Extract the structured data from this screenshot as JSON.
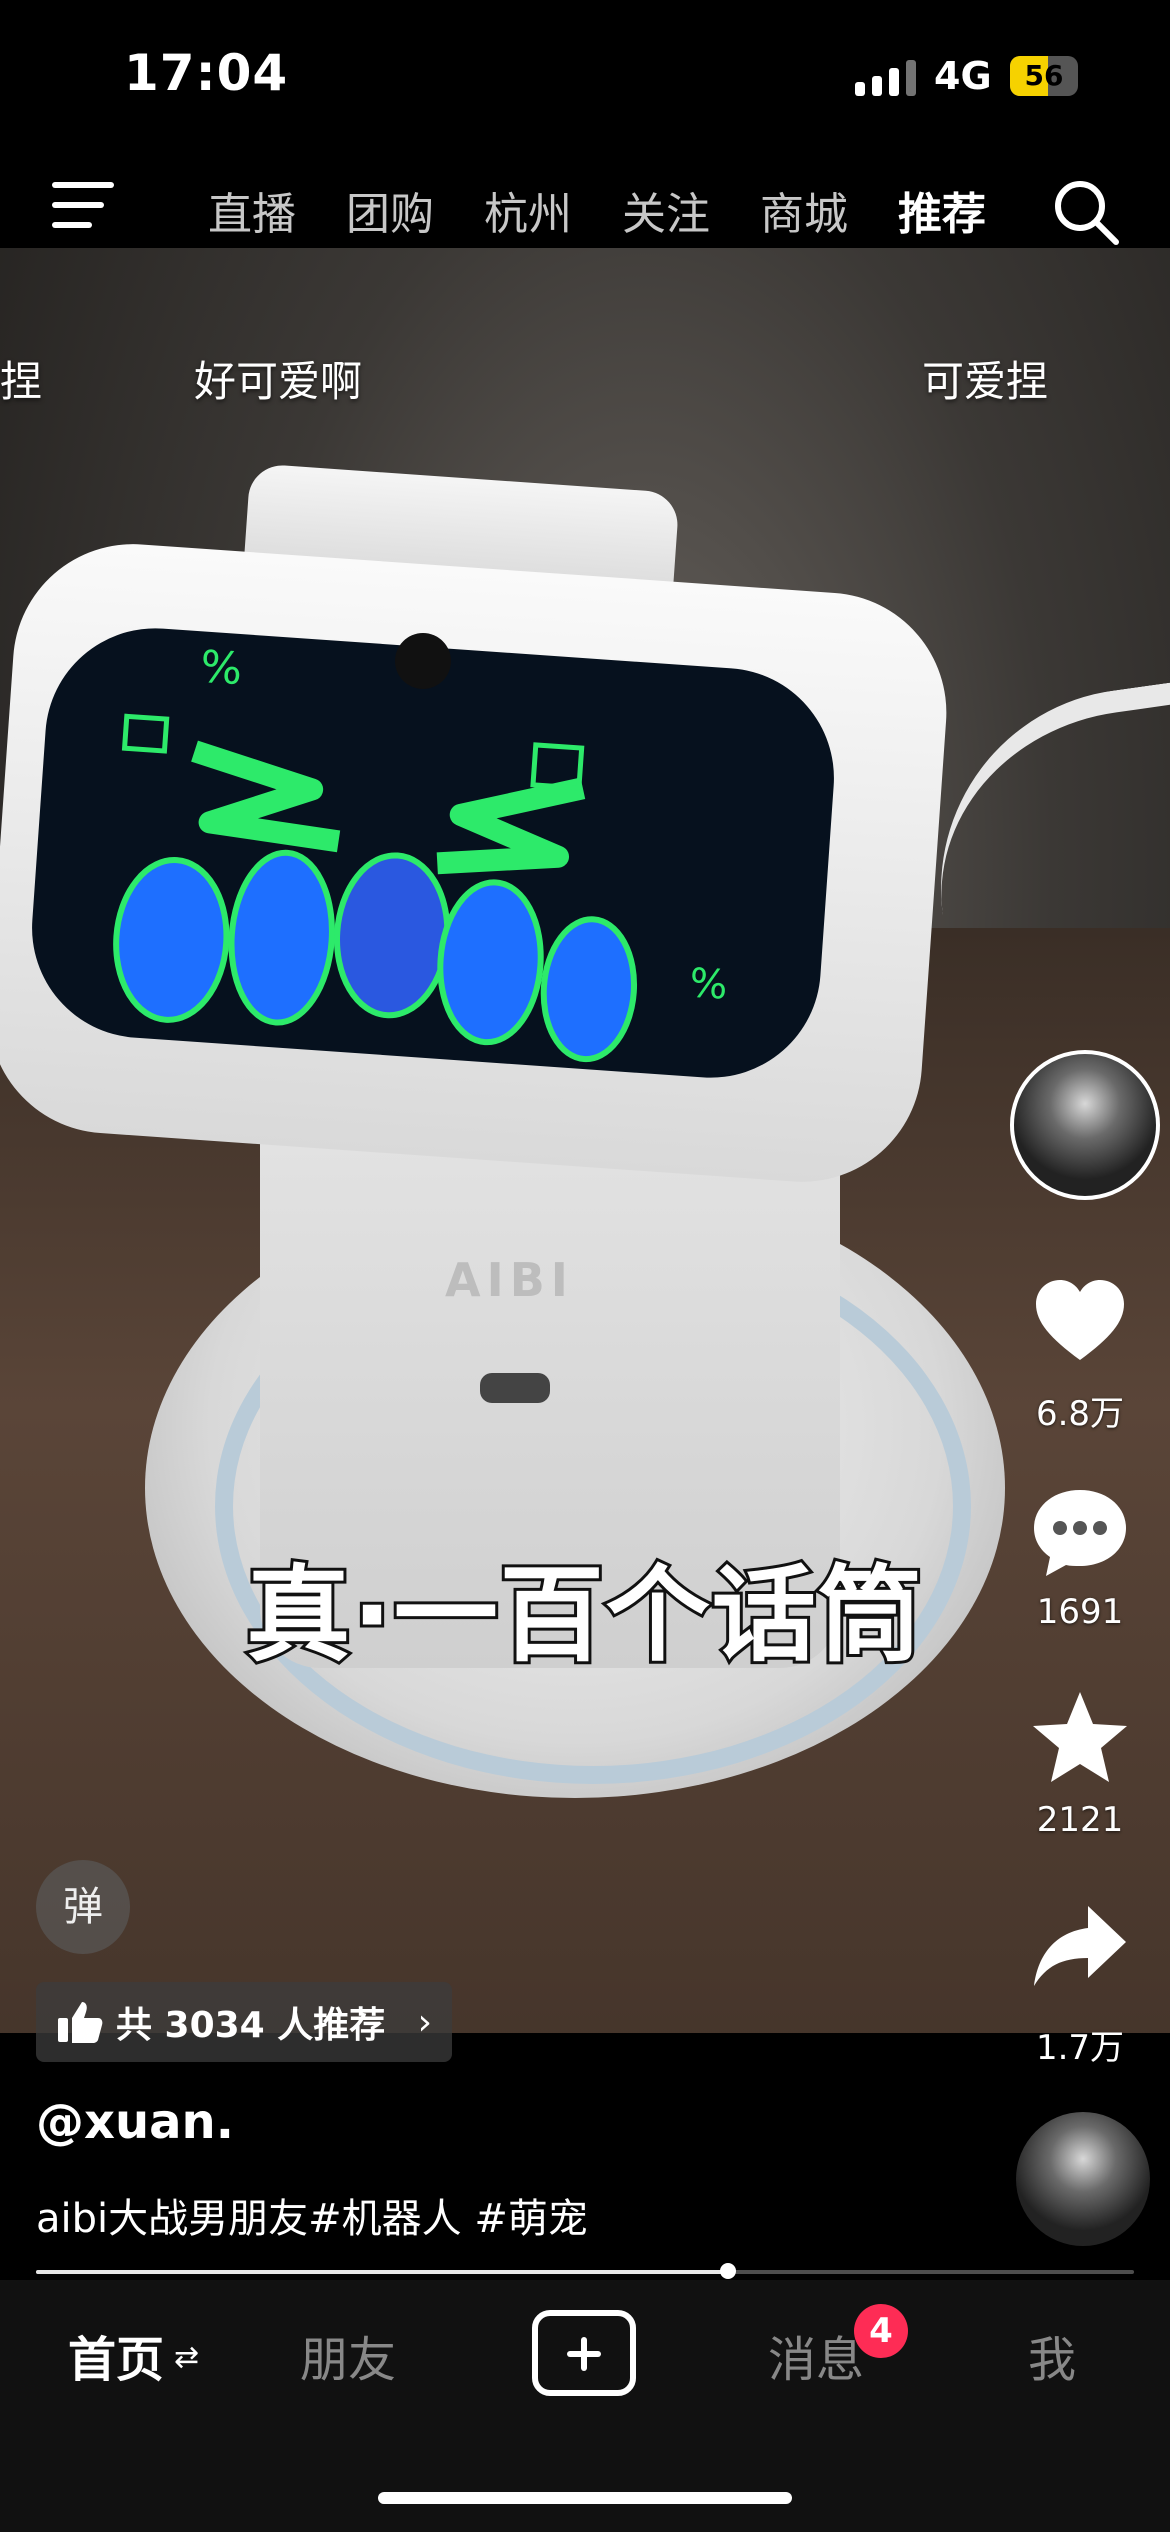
{
  "status_bar": {
    "time": "17:04",
    "network": "4G",
    "battery": "56",
    "battery_level": 0.56
  },
  "top_nav": {
    "tabs": [
      "直播",
      "团购",
      "杭州",
      "关注",
      "商城",
      "推荐"
    ],
    "active_tab": "推荐"
  },
  "danmaku": [
    "捏",
    "好可爱啊",
    "可爱捏"
  ],
  "video": {
    "brand_text": "AIBI",
    "caption": "真·一百个话筒"
  },
  "actions": {
    "likes": "6.8万",
    "comments": "1691",
    "favorites": "2121",
    "shares": "1.7万"
  },
  "overlay": {
    "danmaku_button": "弹",
    "recommend": "共 3034 人推荐",
    "recommend_chevron": "›"
  },
  "post": {
    "username": "@xuan.",
    "description": "aibi大战男朋友#机器人 #萌宠",
    "progress": 0.63
  },
  "bottom_nav": {
    "home": "首页",
    "home_swap": "⇄",
    "friends": "朋友",
    "messages": "消息",
    "messages_badge": "4",
    "me": "我"
  },
  "colors": {
    "badge": "#fe2c55",
    "battery": "#f6d200",
    "screen_green": "#2dea6a",
    "screen_blue": "#1e6fff"
  },
  "icons": [
    "menu-icon",
    "search-icon",
    "heart-icon",
    "comment-icon",
    "star-icon",
    "share-icon",
    "thumbs-up-icon",
    "plus-icon"
  ]
}
